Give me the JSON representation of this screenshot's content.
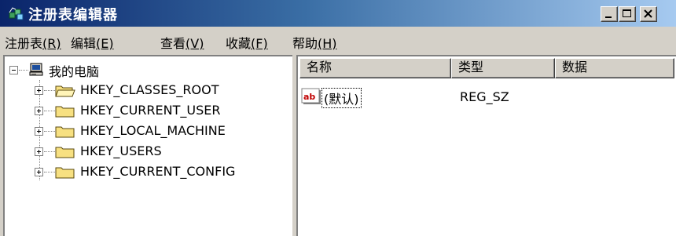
{
  "window": {
    "title": "注册表编辑器",
    "icon": "regedit-icon",
    "controls": [
      "minimize-icon",
      "maximize-icon",
      "close-icon"
    ]
  },
  "menu": {
    "registry": {
      "label": "注册表",
      "accel": "(R)"
    },
    "edit": {
      "label": "编辑",
      "accel": "(E)"
    },
    "view": {
      "label": "查看",
      "accel": "(V)"
    },
    "favorites": {
      "label": "收藏",
      "accel": "(F)"
    },
    "help": {
      "label": "帮助",
      "accel": "(H)"
    }
  },
  "tree": {
    "root": {
      "label": "我的电脑",
      "icon": "computer-icon"
    },
    "keys": [
      {
        "label": "HKEY_CLASSES_ROOT",
        "icon": "folder-icon"
      },
      {
        "label": "HKEY_CURRENT_USER",
        "icon": "folder-icon"
      },
      {
        "label": "HKEY_LOCAL_MACHINE",
        "icon": "folder-icon"
      },
      {
        "label": "HKEY_USERS",
        "icon": "folder-icon"
      },
      {
        "label": "HKEY_CURRENT_CONFIG",
        "icon": "folder-icon"
      }
    ]
  },
  "list": {
    "columns": {
      "name": "名称",
      "type": "类型",
      "data": "数据"
    },
    "rows": [
      {
        "name": "(默认)",
        "type": "REG_SZ",
        "data": "",
        "icon": "string-value-icon"
      }
    ]
  },
  "colors": {
    "title_start": "#0a246a",
    "title_end": "#a6caf0",
    "face": "#d4d0c8",
    "folder": "#f7e081"
  }
}
